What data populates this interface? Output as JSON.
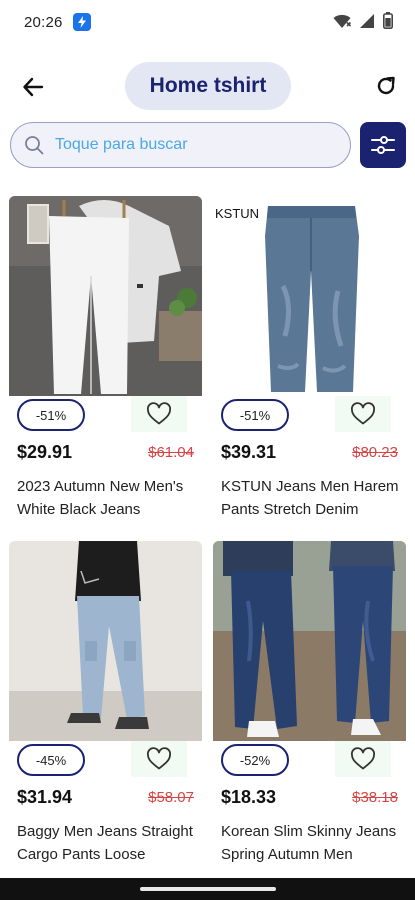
{
  "status_bar": {
    "time": "20:26",
    "icons": [
      "app-notification-icon",
      "wifi-icon",
      "signal-icon",
      "battery-icon"
    ]
  },
  "header": {
    "title": "Home tshirt",
    "back_icon": "arrow-left-icon",
    "refresh_icon": "refresh-icon"
  },
  "search": {
    "placeholder": "Toque para buscar",
    "value": "",
    "filter_icon": "sliders-icon"
  },
  "colors": {
    "brand": "#1b2371",
    "pill": "#e3e6f3",
    "old_price": "#d64545",
    "placeholder": "#4aa8e6"
  },
  "products": [
    {
      "discount": "-51%",
      "price": "$29.91",
      "old_price": "$61.04",
      "name": "2023 Autumn New Men's White Black Jeans"
    },
    {
      "discount": "-51%",
      "price": "$39.31",
      "old_price": "$80.23",
      "name": "KSTUN Jeans Men Harem Pants Stretch Denim",
      "image_text": "KSTUN"
    },
    {
      "discount": "-45%",
      "price": "$31.94",
      "old_price": "$58.07",
      "name": "Baggy Men Jeans Straight Cargo Pants Loose"
    },
    {
      "discount": "-52%",
      "price": "$18.33",
      "old_price": "$38.18",
      "name": "Korean Slim Skinny Jeans Spring Autumn Men"
    }
  ]
}
